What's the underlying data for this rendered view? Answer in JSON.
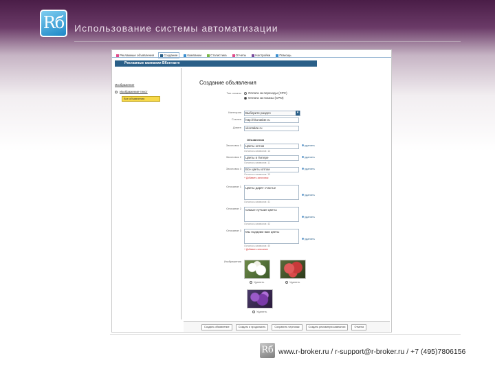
{
  "slide": {
    "logo_text": "Rб",
    "title": "Использование системы автоматизации"
  },
  "app": {
    "tabs": [
      {
        "label": "Рекламные объявления",
        "color": "#e04b8a",
        "active": false
      },
      {
        "label": "Создание",
        "color": "#2a5f88",
        "active": true
      },
      {
        "label": "Кампании",
        "color": "#3a8fd0",
        "active": false
      },
      {
        "label": "Статистика",
        "color": "#7ab648",
        "active": false
      },
      {
        "label": "Отчеты",
        "color": "#e04b8a",
        "active": false
      },
      {
        "label": "Настройки",
        "color": "#7a4a9a",
        "active": false
      },
      {
        "label": "Помощь",
        "color": "#3a8fd0",
        "active": false
      }
    ],
    "banner": "Рекламные кампании ВКонтакте",
    "left": {
      "label": "Изображение",
      "radio_label": "Изображение-текст",
      "button": "Все объявления"
    },
    "form": {
      "title": "Создание объявления",
      "pay_label": "Тип оплаты",
      "pay_options": [
        "Оплата за переходы (CPC)",
        "Оплата за показы (CPM)"
      ],
      "category_label": "Категория",
      "category_value": "Выберите раздел",
      "link_label": "Ссылка",
      "link_value": "http://vkontakte.ru",
      "domain_label": "Домен",
      "domain_value": "vkontakte.ru",
      "section_title": "Объявления",
      "headlines": [
        {
          "label": "Заголовок 1",
          "value": "Цветы оптом",
          "hint": "Осталось символов: 14"
        },
        {
          "label": "Заголовок 2",
          "value": "Цветы в Питере",
          "hint": "Осталось символов: 11"
        },
        {
          "label": "Заголовок 3",
          "value": "Все цветы оптом",
          "hint": "Осталось символов: 10"
        }
      ],
      "add_headline": "+ Добавить заголовок",
      "descriptions": [
        {
          "label": "Описание 1",
          "value": "Цветы дарят счастье",
          "hint": "Осталось символов: 41"
        },
        {
          "label": "Описание 2",
          "value": "Самые лучшие цветы",
          "hint": "Осталось символов: 42"
        },
        {
          "label": "Описание 3",
          "value": "Мы подарим вам цветы",
          "hint": "Осталось символов: 40"
        }
      ],
      "add_description": "+ Добавить описание",
      "delete_label": "удалить",
      "images_label": "Изображения",
      "image_delete": "Удалить"
    },
    "bottom_buttons": [
      "Создать объявление",
      "Создать и продолжить",
      "Сохранить черновик",
      "Создать рекламную кампанию",
      "Отмена"
    ]
  },
  "footer": {
    "logo_text": "Rб",
    "contacts": "www.r-broker.ru / r-support@r-broker.ru / +7 (495)7806156"
  }
}
